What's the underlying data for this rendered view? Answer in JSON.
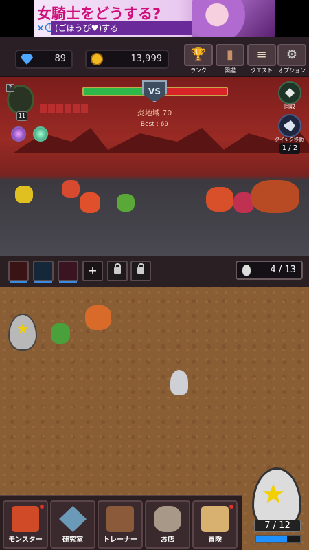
{
  "ad": {
    "headline": "女騎士をどうする?",
    "subline": "(ごほうび♥)する",
    "close": "✕",
    "info": "i"
  },
  "resources": {
    "gems": "89",
    "coins": "13,999"
  },
  "menu": [
    {
      "label": "ランク",
      "icon": "trophy-icon"
    },
    {
      "label": "図鑑",
      "icon": "book-icon"
    },
    {
      "label": "クエスト",
      "icon": "scroll-icon"
    },
    {
      "label": "オプション",
      "icon": "gear-icon"
    }
  ],
  "battle": {
    "vs": "VS",
    "area_name": "炎地域 70",
    "best": "Best : 69",
    "player_hp_ratio": 0.5,
    "player_level": "11",
    "help": "?",
    "collect_label": "回収",
    "quick_move_label": "クイック移動",
    "quick_move_count": "1 / 2"
  },
  "party": {
    "capacity": "4 / 13",
    "add_symbol": "+"
  },
  "egg": {
    "count": "7 / 12",
    "progress": 0.7,
    "star": "★"
  },
  "nav": [
    {
      "label": "モンスター",
      "icon": "dragon-icon",
      "badge": true
    },
    {
      "label": "研究室",
      "icon": "crystal-icon",
      "badge": false
    },
    {
      "label": "トレーナー",
      "icon": "trainer-icon",
      "badge": false
    },
    {
      "label": "お店",
      "icon": "money-bag-icon",
      "badge": false
    },
    {
      "label": "冒険",
      "icon": "map-icon",
      "badge": true
    }
  ],
  "colors": {
    "hp_green": "#2fb84a",
    "hp_red": "#d82428",
    "field": "#8a5e34",
    "notification": "#e0302a"
  }
}
